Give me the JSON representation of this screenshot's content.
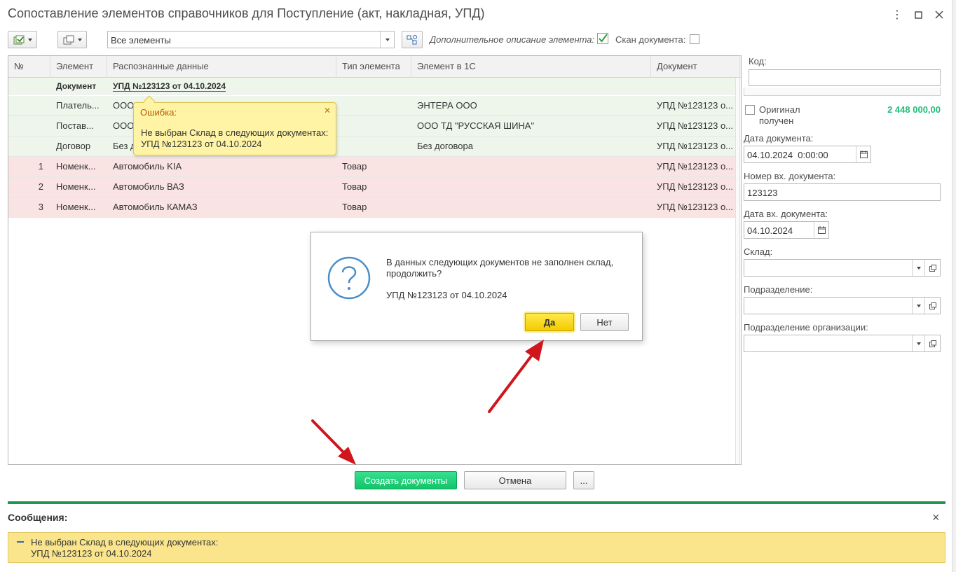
{
  "window": {
    "title": "Сопоставление элементов справочников для Поступление (акт, накладная, УПД)",
    "more_icon": "⋮",
    "maximize_icon": "□",
    "close_icon": "✕"
  },
  "toolbar": {
    "filter_value": "Все элементы",
    "extra_desc_label": "Дополнительное описание элемента:",
    "extra_desc_checked": true,
    "scan_label": "Скан документа:",
    "scan_checked": false
  },
  "table": {
    "columns": [
      "№",
      "Элемент",
      "Распознанные данные",
      "Тип элемента",
      "Элемент в 1С",
      "Документ"
    ],
    "group": {
      "element": "Документ",
      "data": "УПД №123123 от 04.10.2024"
    },
    "rows": [
      {
        "num": "",
        "element": "Платель...",
        "data": "ООО",
        "type": "",
        "element1c": "ЭНТЕРА ООО",
        "document": "УПД №123123 о...",
        "status": "green"
      },
      {
        "num": "",
        "element": "Постав...",
        "data": "ООО",
        "type": "",
        "element1c": "ООО ТД \"РУССКАЯ ШИНА\"",
        "document": "УПД №123123 о...",
        "status": "green"
      },
      {
        "num": "",
        "element": "Договор",
        "data": "Без д",
        "type": "",
        "element1c": "Без договора",
        "document": "УПД №123123 о...",
        "status": "green"
      },
      {
        "num": "1",
        "element": "Номенк...",
        "data": "Автомобиль KIA",
        "type": "Товар",
        "element1c": "",
        "document": "УПД №123123 о...",
        "status": "red"
      },
      {
        "num": "2",
        "element": "Номенк...",
        "data": "Автомобиль ВАЗ",
        "type": "Товар",
        "element1c": "",
        "document": "УПД №123123 о...",
        "status": "red"
      },
      {
        "num": "3",
        "element": "Номенк...",
        "data": "Автомобиль КАМАЗ",
        "type": "Товар",
        "element1c": "",
        "document": "УПД №123123 о...",
        "status": "red"
      }
    ]
  },
  "error_tooltip": {
    "title": "Ошибка:",
    "line1": "Не выбран Склад в следующих документах:",
    "line2": "УПД №123123 от 04.10.2024",
    "close_icon": "✕"
  },
  "dialog": {
    "icon": "?",
    "line1": "В данных следующих документов не заполнен склад,",
    "line2": "продолжить?",
    "line3": "УПД №123123 от 04.10.2024",
    "yes": "Да",
    "no": "Нет"
  },
  "side": {
    "code_label": "Код:",
    "code_value": "",
    "original_label_1": "Оригинал",
    "original_label_2": "получен",
    "original_checked": false,
    "amount": "2 448 000,00",
    "doc_date_label": "Дата документа:",
    "doc_date_value": "04.10.2024  0:00:00",
    "in_number_label": "Номер вх. документа:",
    "in_number_value": "123123",
    "in_date_label": "Дата вх. документа:",
    "in_date_value": "04.10.2024",
    "warehouse_label": "Склад:",
    "warehouse_value": "",
    "division_label": "Подразделение:",
    "division_value": "",
    "org_division_label": "Подразделение организации:",
    "org_division_value": ""
  },
  "actions": {
    "create": "Создать документы",
    "cancel": "Отмена",
    "more": "..."
  },
  "messages": {
    "title": "Сообщения:",
    "line1": "Не выбран Склад в следующих документах:",
    "line2": "УПД №123123 от 04.10.2024",
    "close_icon": "×"
  },
  "colors": {
    "accent_green": "#1c9a4d",
    "amount_green": "#1fbf7a",
    "error_row": "#f9e3e3",
    "ok_row": "#eef6ec",
    "arrow_red": "#d0161c"
  }
}
